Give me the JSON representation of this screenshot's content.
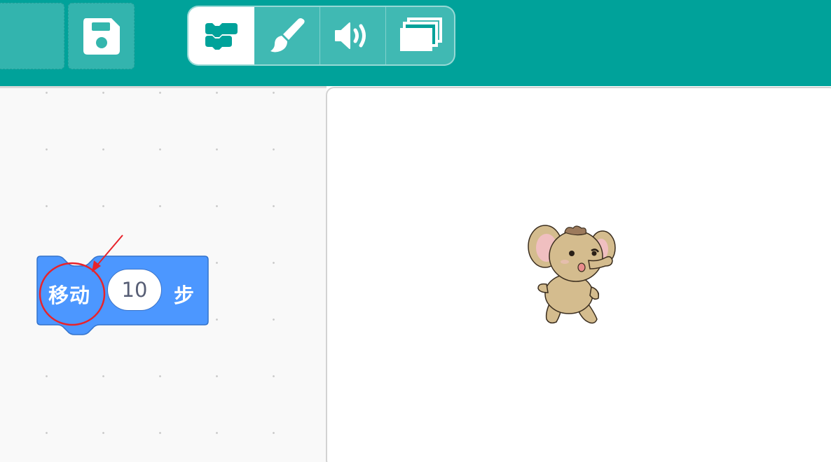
{
  "colors": {
    "topbar": "#00a29a",
    "block_motion": "#4c97ff",
    "annotation_red": "#e8232b"
  },
  "toolbar": {
    "save_icon": "save-disk-icon"
  },
  "tabs": [
    {
      "name": "code",
      "icon": "code-blocks-icon",
      "selected": true
    },
    {
      "name": "costume",
      "icon": "paintbrush-icon",
      "selected": false
    },
    {
      "name": "sound",
      "icon": "speaker-icon",
      "selected": false
    },
    {
      "name": "backdrop",
      "icon": "layers-icon",
      "selected": false
    }
  ],
  "block": {
    "category": "motion",
    "label": "移动",
    "input_value": "10",
    "unit": "步"
  },
  "stage": {
    "sprite": "elephant"
  }
}
